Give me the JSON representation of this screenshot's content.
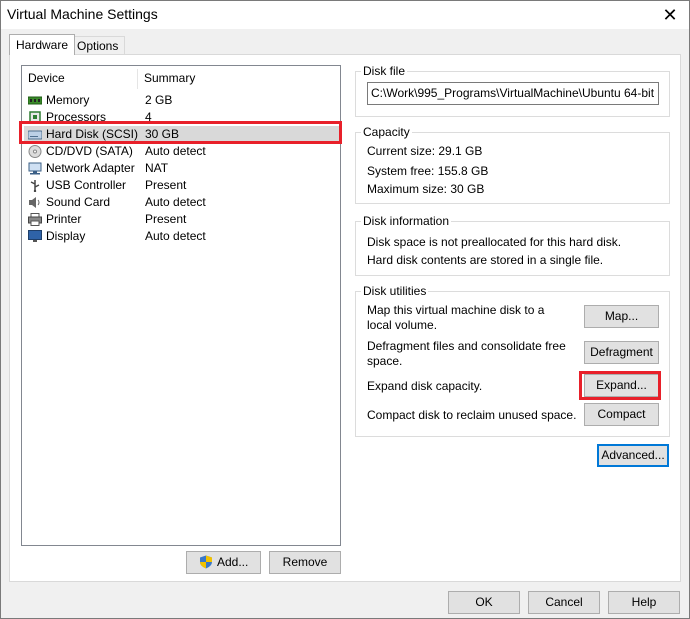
{
  "window": {
    "title": "Virtual Machine Settings",
    "close_label": "✕"
  },
  "tabs": [
    {
      "label": "Hardware"
    },
    {
      "label": "Options"
    }
  ],
  "device_list": {
    "headers": {
      "device": "Device",
      "summary": "Summary"
    },
    "items": [
      {
        "name": "Memory",
        "summary": "2 GB",
        "icon": "memory-icon"
      },
      {
        "name": "Processors",
        "summary": "4",
        "icon": "processor-icon"
      },
      {
        "name": "Hard Disk (SCSI)",
        "summary": "30 GB",
        "icon": "hard-disk-icon",
        "selected": true
      },
      {
        "name": "CD/DVD (SATA)",
        "summary": "Auto detect",
        "icon": "cd-dvd-icon"
      },
      {
        "name": "Network Adapter",
        "summary": "NAT",
        "icon": "network-adapter-icon"
      },
      {
        "name": "USB Controller",
        "summary": "Present",
        "icon": "usb-icon"
      },
      {
        "name": "Sound Card",
        "summary": "Auto detect",
        "icon": "sound-card-icon"
      },
      {
        "name": "Printer",
        "summary": "Present",
        "icon": "printer-icon"
      },
      {
        "name": "Display",
        "summary": "Auto detect",
        "icon": "display-icon"
      }
    ],
    "add_label": "Add...",
    "remove_label": "Remove"
  },
  "disk_file": {
    "group_label": "Disk file",
    "value": "C:\\Work\\995_Programs\\VirtualMachine\\Ubuntu 64-bit"
  },
  "capacity": {
    "group_label": "Capacity",
    "current_size": "Current size:  29.1 GB",
    "system_free": "System free:  155.8 GB",
    "maximum_size": "Maximum size:  30 GB"
  },
  "disk_information": {
    "group_label": "Disk information",
    "line1": "Disk space is not preallocated for this hard disk.",
    "line2": "Hard disk contents are stored in a single file."
  },
  "disk_utilities": {
    "group_label": "Disk utilities",
    "map_text": "Map this virtual machine disk to a local volume.",
    "map_button": "Map...",
    "defrag_text": "Defragment files and consolidate free space.",
    "defrag_button": "Defragment",
    "expand_text": "Expand disk capacity.",
    "expand_button": "Expand...",
    "compact_text": "Compact disk to reclaim unused space.",
    "compact_button": "Compact"
  },
  "advanced_button": "Advanced...",
  "footer": {
    "ok": "OK",
    "cancel": "Cancel",
    "help": "Help"
  },
  "colors": {
    "highlight_red": "#e8202a",
    "focus_blue": "#0078d7",
    "selected_row": "#d9d9d9"
  }
}
